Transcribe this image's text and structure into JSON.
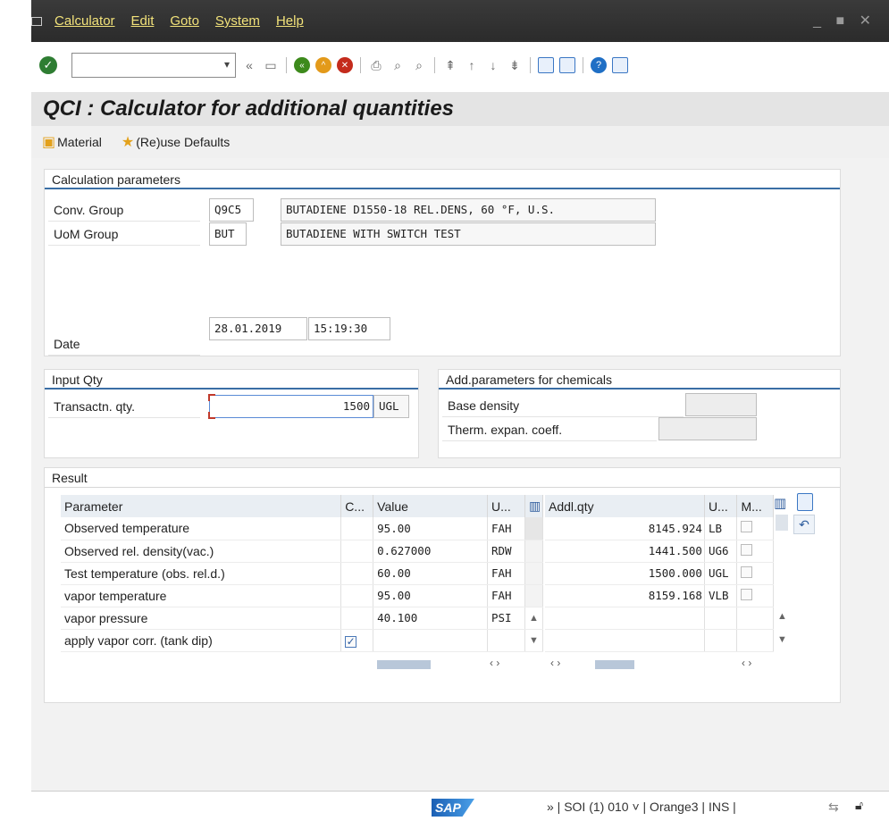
{
  "menu": {
    "items": [
      "Calculator",
      "Edit",
      "Goto",
      "System",
      "Help"
    ],
    "window_controls": "_ ■ ✕"
  },
  "toolbar": {
    "command_field_value": ""
  },
  "title": "QCI : Calculator for additional quantities",
  "app_toolbar": {
    "material_label": "Material",
    "defaults_label": "(Re)use Defaults"
  },
  "calc_params": {
    "title": "Calculation parameters",
    "conv_group_label": "Conv. Group",
    "conv_group_value": "Q9C5",
    "conv_group_desc": "BUTADIENE D1550-18 REL.DENS, 60 °F, U.S.",
    "uom_group_label": "UoM Group",
    "uom_group_value": "BUT",
    "uom_group_desc": "BUTADIENE WITH SWITCH TEST",
    "date_label": "Date",
    "date_value": "28.01.2019",
    "time_value": "15:19:30"
  },
  "input_qty": {
    "title": "Input Qty",
    "label": "Transactn. qty.",
    "value": "1500",
    "unit": "UGL"
  },
  "chem_params": {
    "title": "Add.parameters for chemicals",
    "base_density_label": "Base density",
    "therm_label": "Therm. expan. coeff."
  },
  "result": {
    "title": "Result",
    "headers": {
      "parameter": "Parameter",
      "c": "C...",
      "value": "Value",
      "unit": "U...",
      "addl_qty": "Addl.qty",
      "unit2": "U...",
      "m": "M..."
    },
    "rows": [
      {
        "parameter": "Observed temperature",
        "checked": false,
        "value": "95.00",
        "unit": "FAH"
      },
      {
        "parameter": "Observed rel. density(vac.)",
        "checked": false,
        "value": "0.627000",
        "unit": "RDW"
      },
      {
        "parameter": "Test temperature (obs. rel.d.)",
        "checked": false,
        "value": "60.00",
        "unit": "FAH"
      },
      {
        "parameter": "vapor temperature",
        "checked": false,
        "value": "95.00",
        "unit": "FAH"
      },
      {
        "parameter": "vapor pressure",
        "checked": false,
        "value": "40.100",
        "unit": "PSI"
      },
      {
        "parameter": "apply vapor corr. (tank dip)",
        "checked": true,
        "value": "",
        "unit": ""
      }
    ],
    "addl_rows": [
      {
        "qty": "8145.924",
        "unit": "LB"
      },
      {
        "qty": "1441.500",
        "unit": "UG6"
      },
      {
        "qty": "1500.000",
        "unit": "UGL"
      },
      {
        "qty": "8159.168",
        "unit": "VLB"
      }
    ]
  },
  "status": {
    "text": "» | SOI (1) 010 ˅ | Orange3 | INS |",
    "logo": "SAP"
  }
}
